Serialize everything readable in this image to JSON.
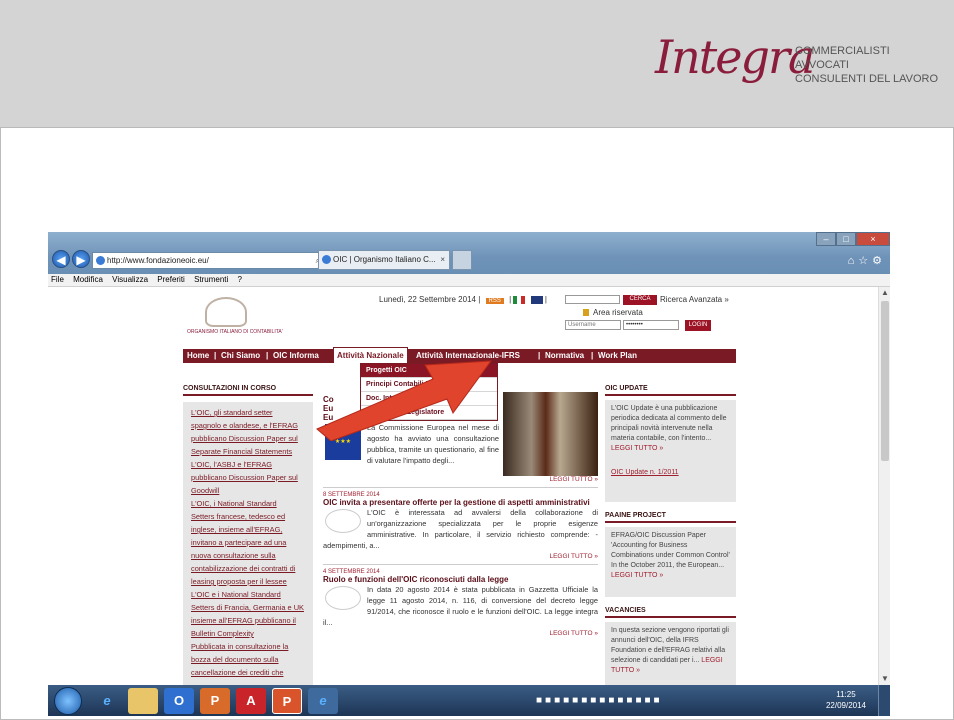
{
  "slide": {
    "logo_script": "Integra",
    "logo_lines": [
      "COMMERCIALISTI",
      "AVVOCATI",
      "CONSULENTI DEL LAVORO"
    ]
  },
  "browser": {
    "url": "http://www.fondazioneoic.eu/",
    "tab_title": "OIC | Organismo Italiano C...",
    "menu": [
      "File",
      "Modifica",
      "Visualizza",
      "Preferiti",
      "Strumenti",
      "?"
    ]
  },
  "site": {
    "logo_name": "ORGANISMO ITALIANO DI CONTABILITA'",
    "date_line": "Lunedì, 22 Settembre 2014",
    "rss_label": "RSS",
    "search_button": "CERCA",
    "advanced_search": "Ricerca Avanzata »",
    "area_riservata": "Area riservata",
    "username_placeholder": "Username",
    "password_value": "••••••••",
    "login_button": "LOGIN",
    "nav": {
      "home": "Home",
      "chi_siamo": "Chi Siamo",
      "oic_informa": "OIC Informa",
      "attivita_nazionale": "Attività Nazionale",
      "attivita_internazionale": "Attività Internazionale-IFRS",
      "normativa": "Normativa",
      "work_plan": "Work Plan"
    },
    "dropdown": [
      "Progetti OIC",
      "Principi Contabili Nazionali",
      "Doc. Interpretativi di Norme",
      "Supporto al Legislatore"
    ],
    "left": {
      "title": "CONSULTAZIONI IN CORSO",
      "items": [
        "L'OIC, gli standard setter",
        "spagnolo e olandese, e l'EFRAG",
        "pubblicano Discussion Paper sul",
        "Separate Financial Statements",
        "L'OIC, l'ASBJ e l'EFRAG",
        "pubblicano Discussion Paper sul",
        "Goodwill",
        "L'OIC, i National Standard",
        "Setters francese, tedesco ed",
        "inglese, insieme all'EFRAG,",
        "invitano a partecipare ad una",
        "nuova consultazione sulla",
        "contabilizzazione dei contratti di",
        "leasing proposta per il lessee",
        "L'OIC e i National Standard",
        "Setters di Francia, Germania e UK",
        "insieme all'EFRAG pubblicano il",
        "Bulletin Complexity",
        "Pubblicata in consultazione la",
        "bozza del documento sulla",
        "cancellazione dei crediti che"
      ]
    },
    "articles": [
      {
        "date": "",
        "title": "Co",
        "title2": "Eu",
        "title3": "Eu",
        "body": "La Commissione Europea nel mese di agosto ha avviato una consultazione pubblica, tramite un questionario, al fine di valutare l'impatto degli...",
        "more": "LEGGI TUTTO »"
      },
      {
        "date": "8 SETTEMBRE 2014",
        "title": "OIC invita a presentare offerte per la gestione di aspetti amministrativi",
        "body": "L'OIC è interessata ad avvalersi della collaborazione di un'organizzazione specializzata per le proprie esigenze amministrative. In particolare, il servizio richiesto comprende: - adempimenti, a...",
        "more": "LEGGI TUTTO »"
      },
      {
        "date": "4 SETTEMBRE 2014",
        "title": "Ruolo e funzioni dell'OIC riconosciuti dalla legge",
        "body": "In data 20 agosto 2014 è stata pubblicata in Gazzetta Ufficiale la legge 11 agosto 2014, n. 116, di conversione del decreto legge 91/2014, che riconosce il ruolo e le funzioni dell'OIC. La legge integra il...",
        "more": "LEGGI TUTTO »"
      }
    ],
    "right": {
      "update_title": "OIC UPDATE",
      "update_body": "L'OIC Update è una pubblicazione periodica dedicata al commento delle principali novità intervenute nella materia contabile, con l'intento...",
      "update_more": "LEGGI TUTTO »",
      "update_link": "OIC Update n. 1/2011",
      "paaine_title": "PAAINE PROJECT",
      "paaine_body": "EFRAG/OIC Discussion Paper 'Accounting for Business Combinations under Common Control' In the October 2011, the European...",
      "paaine_more": "LEGGI TUTTO »",
      "vacancies_title": "VACANCIES",
      "vacancies_body": "In questa sezione vengono riportati gli annunci dell'OIC, della IFRS Foundation e dell'EFRAG relativi alla selezione di candidati per i...",
      "vacancies_more": "LEGGI TUTTO »"
    }
  },
  "taskbar": {
    "time": "11:25",
    "date": "22/09/2014"
  },
  "colors": {
    "brand": "#7a1a24",
    "accent": "#9c1326"
  }
}
